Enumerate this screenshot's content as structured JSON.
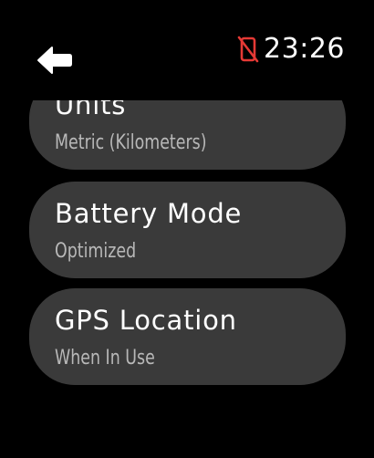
{
  "status": {
    "time": "23:26",
    "connection_icon": "phone-disconnected-icon",
    "connection_color": "#e53935"
  },
  "navigation": {
    "back_icon": "back-arrow-icon"
  },
  "settings": {
    "items": [
      {
        "title": "Units",
        "value": "Metric (Kilometers)"
      },
      {
        "title": "Battery Mode",
        "value": "Optimized"
      },
      {
        "title": "GPS Location",
        "value": "When In Use"
      }
    ]
  },
  "colors": {
    "background": "#000000",
    "card": "#3a3a3a",
    "subtitle": "#b8b8b8"
  }
}
